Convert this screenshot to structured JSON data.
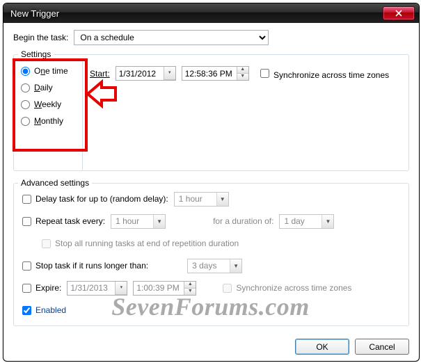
{
  "window": {
    "title": "New Trigger"
  },
  "begin": {
    "label": "Begin the task:",
    "value": "On a schedule"
  },
  "settings": {
    "legend": "Settings",
    "freq": {
      "onetime_pre": "O",
      "onetime_key": "n",
      "onetime_post": "e time",
      "daily_key": "D",
      "daily_post": "aily",
      "weekly_key": "W",
      "weekly_post": "eekly",
      "monthly_key": "M",
      "monthly_post": "onthly"
    },
    "start_pre": "S",
    "start_key": "t",
    "start_post": "art:",
    "date": "1/31/2012",
    "time": "12:58:36 PM",
    "sync_label": "Synchronize across time zones"
  },
  "adv": {
    "legend": "Advanced settings",
    "delay_label": "Delay task for up to (random delay):",
    "delay_value": "1 hour",
    "repeat_label": "Repeat task every:",
    "repeat_value": "1 hour",
    "duration_label": "for a duration of:",
    "duration_value": "1 day",
    "stopall_label": "Stop all running tasks at end of repetition duration",
    "stoplong_label": "Stop task if it runs longer than:",
    "stoplong_value": "3 days",
    "expire_label": "Expire:",
    "expire_date": "1/31/2013",
    "expire_time": "1:00:39 PM",
    "expire_sync": "Synchronize across time zones",
    "enabled_label": "Enabled"
  },
  "buttons": {
    "ok": "OK",
    "cancel": "Cancel"
  },
  "watermark": "SevenForums.com"
}
